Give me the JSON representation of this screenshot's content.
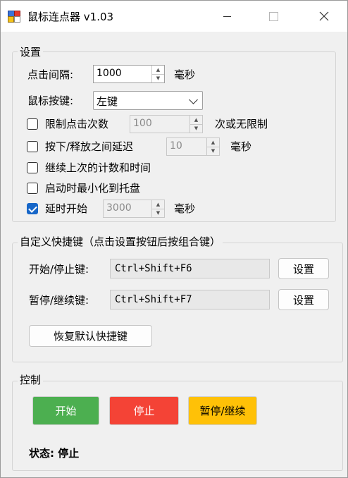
{
  "window": {
    "title": "鼠标连点器 v1.03"
  },
  "settings": {
    "group_title": "设置",
    "interval_label": "点击间隔:",
    "interval_value": "1000",
    "interval_unit": "毫秒",
    "button_label": "鼠标按键:",
    "button_value": "左键",
    "limit_label": "限制点击次数",
    "limit_value": "100",
    "limit_suffix": "次或无限制",
    "press_delay_label": "按下/释放之间延迟",
    "press_delay_value": "10",
    "press_delay_unit": "毫秒",
    "continue_label": "继续上次的计数和时间",
    "minimize_label": "启动时最小化到托盘",
    "delay_start_label": "延时开始",
    "delay_start_value": "3000",
    "delay_start_unit": "毫秒"
  },
  "checkboxes": {
    "limit": false,
    "press_delay": false,
    "continue": false,
    "minimize": false,
    "delay_start": true
  },
  "hotkeys": {
    "group_title": "自定义快捷键（点击设置按钮后按组合键）",
    "start_stop_label": "开始/停止键:",
    "start_stop_value": "Ctrl+Shift+F6",
    "pause_resume_label": "暂停/继续键:",
    "pause_resume_value": "Ctrl+Shift+F7",
    "set_label": "设置",
    "reset_label": "恢复默认快捷键"
  },
  "control": {
    "group_title": "控制",
    "start_label": "开始",
    "stop_label": "停止",
    "pause_label": "暂停/继续",
    "status_text": "状态: 停止"
  },
  "colors": {
    "start": "#4caf50",
    "stop": "#f44336",
    "pause": "#ffc107",
    "accent": "#1666c8"
  }
}
